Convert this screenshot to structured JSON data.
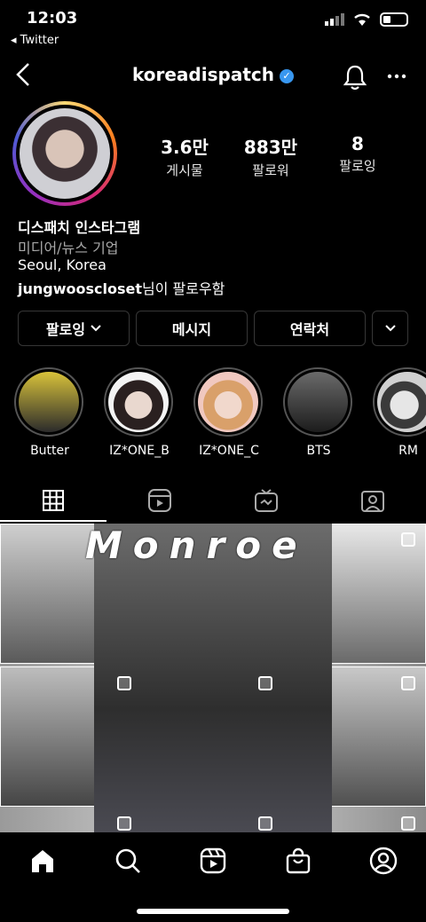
{
  "status": {
    "time": "12:03",
    "back_app": "◂ Twitter"
  },
  "header": {
    "username": "koreadispatch"
  },
  "stats": [
    {
      "value": "3.6만",
      "label": "게시물"
    },
    {
      "value": "883만",
      "label": "팔로워"
    },
    {
      "value": "8",
      "label": "팔로잉"
    }
  ],
  "bio": {
    "name": "디스패치 인스타그램",
    "category": "미디어/뉴스 기업",
    "location": "Seoul, Korea",
    "followed_by_user": "jungwooscloset",
    "followed_by_suffix": "님이 팔로우함"
  },
  "buttons": {
    "following": "팔로잉",
    "message": "메시지",
    "contact": "연락처"
  },
  "highlights": [
    {
      "label": "Butter",
      "color": "#d8c23a"
    },
    {
      "label": "IZ*ONE_B",
      "color": "#e9d8cf"
    },
    {
      "label": "IZ*ONE_C",
      "color": "#e6c6bf"
    },
    {
      "label": "BTS",
      "color": "#3a3a3a"
    },
    {
      "label": "RM",
      "color": "#cfcfcf"
    }
  ],
  "grid": {
    "banner_text": "Monroe"
  }
}
